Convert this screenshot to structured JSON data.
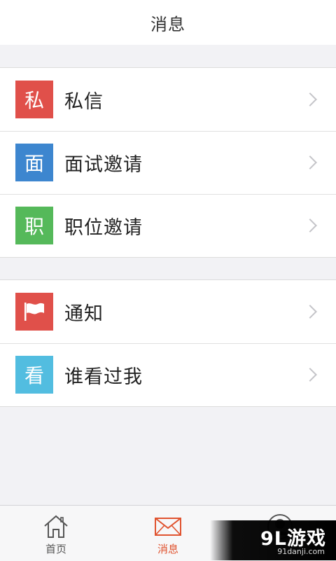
{
  "header": {
    "title": "消息"
  },
  "groups": [
    {
      "items": [
        {
          "badge": "私",
          "badge_color": "#e0504a",
          "label": "私信"
        },
        {
          "badge": "面",
          "badge_color": "#3d86cf",
          "label": "面试邀请"
        },
        {
          "badge": "职",
          "badge_color": "#55b95a",
          "label": "职位邀请"
        }
      ]
    },
    {
      "items": [
        {
          "badge_icon": "flag-icon",
          "badge_color": "#e0504a",
          "label": "通知"
        },
        {
          "badge": "看",
          "badge_color": "#52bde0",
          "label": "谁看过我"
        }
      ]
    }
  ],
  "tabbar": {
    "tabs": [
      {
        "label": "首页",
        "icon": "home-icon",
        "active": false
      },
      {
        "label": "消息",
        "icon": "mail-icon",
        "active": true
      },
      {
        "label": "",
        "icon": "profile-icon",
        "active": false
      }
    ]
  },
  "colors": {
    "accent": "#e0532f",
    "background": "#f2f2f5"
  },
  "watermark": {
    "brand": "9L游戏",
    "url": "91danji.com"
  }
}
